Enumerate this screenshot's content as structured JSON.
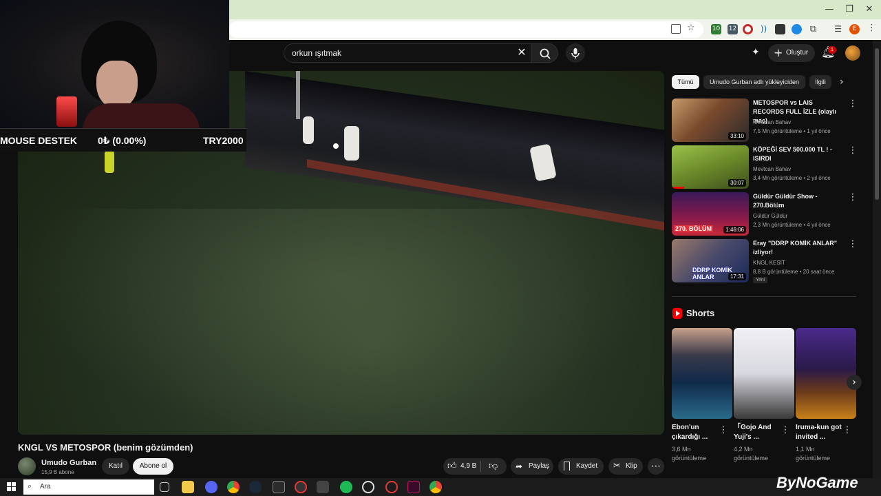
{
  "browser": {
    "window_controls": {
      "minimize": "—",
      "restore": "❐",
      "close": "✕"
    },
    "extension_badges": {
      "ext1": "10",
      "ext2": "12",
      "profile": "E"
    }
  },
  "header": {
    "search_query": "orkun ışıtmak",
    "create_label": "Oluştur",
    "notification_count": "1"
  },
  "overlay": {
    "donation_label": "MOUSE DESTEK",
    "donation_progress": "0₺ (0.00%)",
    "donation_goal": "TRY2000"
  },
  "video": {
    "title": "KNGL VS METOSPOR (benim gözümden)",
    "channel_name": "Umudo Gurban",
    "subscribers": "15,9 B abone",
    "join_label": "Katıl",
    "subscribe_label": "Abone ol",
    "like_count": "4,9 B",
    "share_label": "Paylaş",
    "save_label": "Kaydet",
    "clip_label": "Klip"
  },
  "sidebar": {
    "chips": [
      "Tümü",
      "Umudo Gurban adlı yükleyiciden",
      "İlgili"
    ],
    "recommendations": [
      {
        "title": "METOSPOR vs LAIS RECORDS FULL İZLE (olaylı maç)",
        "channel": "Mevtcan Bahav",
        "meta": "7,5 Mn görüntüleme • 1 yıl önce",
        "duration": "33:10"
      },
      {
        "title": "KÖPEĞİ SEV 500.000 TL ! - ISIRDI",
        "channel": "Mevtcan Bahav",
        "meta": "3,4 Mn görüntüleme • 2 yıl önce",
        "duration": "30:07"
      },
      {
        "title": "Güldür Güldür Show - 270.Bölüm",
        "channel": "Güldür Güldür",
        "meta": "2,3 Mn görüntüleme • 4 yıl önce",
        "duration": "1:46:06",
        "thumb_text": "270. BÖLÜM"
      },
      {
        "title": "Eray \"DDRP KOMİK ANLAR\" izliyor!",
        "channel": "KNGL KESİT",
        "meta": "8,8 B görüntüleme • 20 saat önce",
        "duration": "17:31",
        "badge": "Yeni",
        "thumb_text": "DDRP KOMİK ANLAR"
      }
    ],
    "shorts_header": "Shorts",
    "shorts": [
      {
        "title": "Ebon'un çıkardığı ...",
        "views": "3,6 Mn görüntüleme"
      },
      {
        "title": "「Gojo And Yuji's ...",
        "views": "4,2 Mn görüntüleme"
      },
      {
        "title": "Iruma-kun got invited ...",
        "views": "1,1 Mn görüntüleme"
      }
    ]
  },
  "taskbar": {
    "search_placeholder": "Ara",
    "watermark": "ByNoGame"
  },
  "colors": {
    "yt_bg": "#0f0f0f",
    "accent_red": "#ff0000",
    "chrome_top": "#d7e9c8"
  }
}
